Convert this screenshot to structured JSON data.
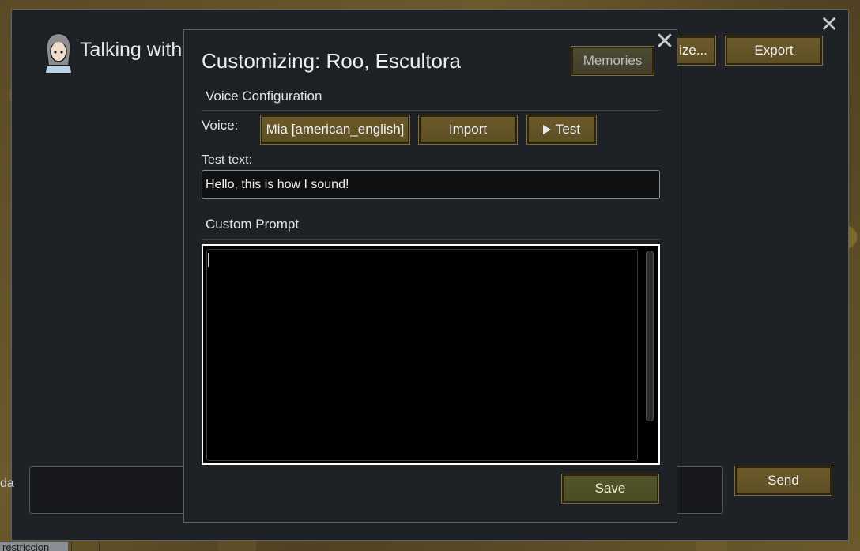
{
  "outer": {
    "title": "Talking with",
    "customize_label": "ize...",
    "export_label": "Export",
    "send_label": "Send",
    "left_fragment": "da",
    "bottom_tab": "restriccion"
  },
  "dialog": {
    "title": "Customizing: Roo, Escultora",
    "memories_label": "Memories",
    "voice_section": "Voice Configuration",
    "voice_label": "Voice:",
    "voice_value": "Mia [american_english]",
    "import_label": "Import",
    "test_label": "Test",
    "test_text_label": "Test text:",
    "test_text_value": "Hello, this is how I sound!",
    "custom_prompt_section": "Custom Prompt",
    "custom_prompt_value": "",
    "save_label": "Save"
  }
}
